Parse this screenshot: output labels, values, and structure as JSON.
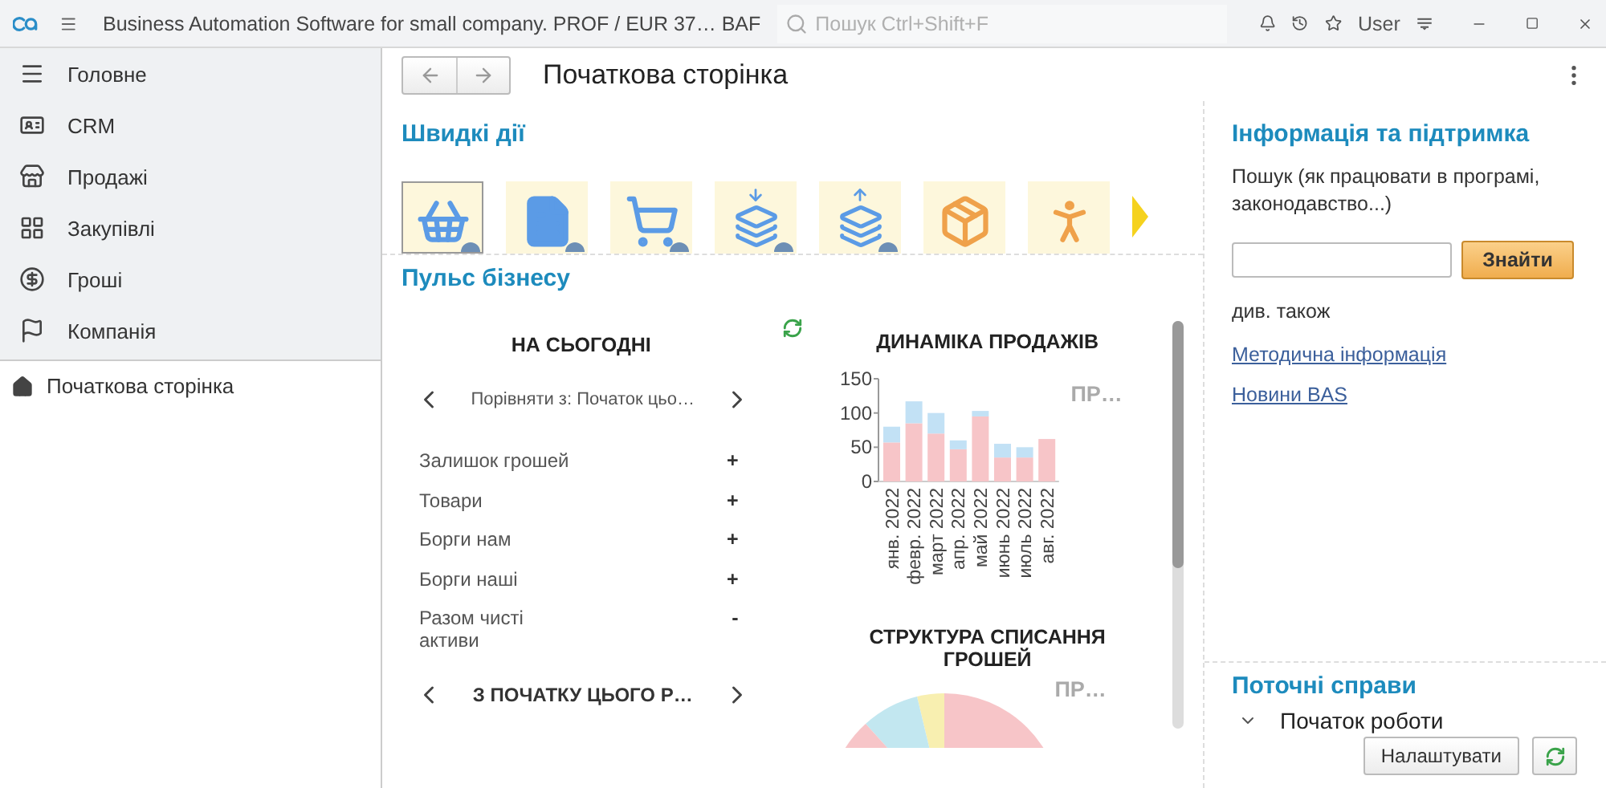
{
  "title_bar": {
    "app_title": "Business Automation Software for small company. PROF / EUR 37… BAF",
    "search": {
      "placeholder": "Пошук Ctrl+Shift+F"
    },
    "user": "User"
  },
  "sidebar": {
    "items": [
      {
        "label": "Головне"
      },
      {
        "label": "CRM"
      },
      {
        "label": "Продажі"
      },
      {
        "label": "Закупівлі"
      },
      {
        "label": "Гроші"
      },
      {
        "label": "Компанія"
      }
    ],
    "open_pages": [
      {
        "label": "Початкова сторінка",
        "selected": true
      }
    ]
  },
  "page": {
    "title": "Початкова сторінка"
  },
  "quick_actions": {
    "title": "Швидкі дії",
    "tiles": [
      {
        "selected": true,
        "badge": true
      },
      {
        "selected": false,
        "badge": true
      },
      {
        "selected": false,
        "badge": true
      },
      {
        "selected": false,
        "badge": true
      },
      {
        "selected": false,
        "badge": true
      },
      {
        "selected": false,
        "badge": false
      },
      {
        "selected": false,
        "badge": false
      }
    ]
  },
  "pulse": {
    "title": "Пульс бізнесу",
    "today": {
      "title": "НА СЬОГОДНІ",
      "compare": "Порівняти з: Початок цьо…",
      "rows": [
        {
          "label": "Залишок грошей",
          "value": "+"
        },
        {
          "label": "Товари",
          "value": "+"
        },
        {
          "label": "Борги нам",
          "value": "+"
        },
        {
          "label": "Борги наші",
          "value": "+"
        },
        {
          "label": "Разом чисті активи",
          "value": "-"
        }
      ],
      "period": "З ПОЧАТКУ ЦЬОГО Р…"
    },
    "sales": {
      "title": "ДИНАМІКА ПРОДАЖІВ",
      "legend": "ПР…",
      "chart_data": {
        "type": "bar",
        "stacked": true,
        "categories": [
          "янв. 2022",
          "февр. 2022",
          "март 2022",
          "апр. 2022",
          "май 2022",
          "июнь 2022",
          "июль 2022",
          "авг. 2022"
        ],
        "ylim": [
          0,
          150
        ],
        "yticks": [
          0,
          50,
          100,
          150
        ],
        "series": [
          {
            "color": "#f7c5c8",
            "values": [
              57,
              85,
              70,
              47,
              95,
              35,
              35,
              62
            ]
          },
          {
            "color": "#c2e1f5",
            "values": [
              23,
              32,
              30,
              13,
              8,
              20,
              15,
              0
            ]
          }
        ]
      }
    },
    "cash_structure": {
      "title": "СТРУКТУРА СПИСАННЯ ГРОШЕЙ",
      "legend": "ПР…"
    }
  },
  "info": {
    "title": "Інформація та підтримка",
    "search_label": "Пошук (як працювати в програмі, законодавство...)",
    "search_button": "Знайти",
    "see_also": "див. також",
    "links": [
      "Методична інформація",
      "Новини BAS"
    ]
  },
  "tasks": {
    "title": "Поточні справи",
    "items": [
      {
        "label": "Початок роботи",
        "expanded": true
      }
    ],
    "settings_button": "Налаштувати"
  }
}
